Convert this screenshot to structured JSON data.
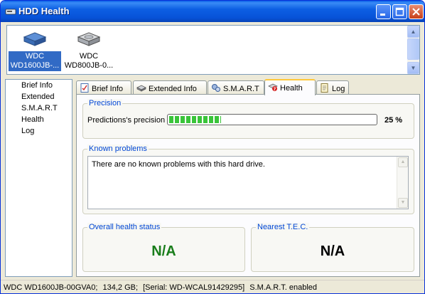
{
  "window": {
    "title": "HDD Health"
  },
  "drives": [
    {
      "label": "WDC WD1600JB-...",
      "line1": "WDC",
      "line2": "WD1600JB-...",
      "selected": true
    },
    {
      "label": "WDC WD800JB-0...",
      "line1": "WDC",
      "line2": "WD800JB-0...",
      "selected": false
    }
  ],
  "nav": {
    "items": [
      "Brief Info",
      "Extended",
      "S.M.A.R.T",
      "Health",
      "Log"
    ]
  },
  "tabs": [
    {
      "label": "Brief Info",
      "icon": "brief-info-icon"
    },
    {
      "label": "Extended Info",
      "icon": "drive-icon"
    },
    {
      "label": "S.M.A.R.T",
      "icon": "smart-icon"
    },
    {
      "label": "Health",
      "icon": "health-icon",
      "active": true
    },
    {
      "label": "Log",
      "icon": "log-icon"
    }
  ],
  "health": {
    "precision_group": "Precision",
    "precision_label": "Predictions's precision",
    "precision_value": "25 %",
    "precision_fraction": 0.25,
    "known_group": "Known problems",
    "known_text": "There are no known problems with this hard drive.",
    "overall_group": "Overall health status",
    "overall_value": "N/A",
    "tec_group": "Nearest T.E.C.",
    "tec_value": "N/A"
  },
  "status": {
    "model": "WDC WD1600JB-00GVA0;",
    "capacity": "134,2 GB;",
    "serial": "[Serial: WD-WCAL91429295]",
    "smart": "S.M.A.R.T. enabled"
  },
  "colors": {
    "title_bar": "#0752d8",
    "accent_blue": "#0046d5",
    "progress": "#3ac43a",
    "overall_status": "#197d1a"
  }
}
